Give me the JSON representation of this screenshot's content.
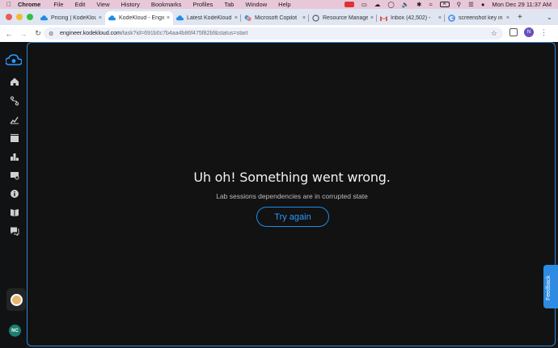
{
  "menubar": {
    "app": "Chrome",
    "items": [
      "File",
      "Edit",
      "View",
      "History",
      "Bookmarks",
      "Profiles",
      "Tab",
      "Window",
      "Help"
    ],
    "datetime": "Mon Dec 29  11:37 AM"
  },
  "tabs": [
    {
      "title": "Pricing | KodeKloud",
      "favicon": "kodekloud-cloud-icon",
      "active": false
    },
    {
      "title": "KodeKloud - Engineer",
      "favicon": "kodekloud-cloud-icon",
      "active": true
    },
    {
      "title": "Latest KodeKloud",
      "favicon": "kodekloud-cloud-icon",
      "active": false
    },
    {
      "title": "Microsoft Copilot",
      "favicon": "copilot-icon",
      "active": false
    },
    {
      "title": "Resource Manager",
      "favicon": "globe-icon",
      "active": false
    },
    {
      "title": "Inbox (42,502) -",
      "favicon": "gmail-icon",
      "active": false
    },
    {
      "title": "screenshot key in",
      "favicon": "google-icon",
      "active": false
    }
  ],
  "omnibox": {
    "domain": "engineer.kodekloud.com",
    "path": "/task?id=691b0c7b4aa4b86f475f82bf&status=start"
  },
  "profile": {
    "initial": "N"
  },
  "sidebar": {
    "icons": [
      "home-icon",
      "route-icon",
      "chart-icon",
      "video-icon",
      "leaderboard-icon",
      "certificate-icon",
      "info-icon",
      "book-icon",
      "chat-icon"
    ],
    "user_initials": "NC"
  },
  "error": {
    "title": "Uh oh! Something went wrong.",
    "subtitle": "Lab sessions dependencies are in corrupted state",
    "button": "Try again"
  },
  "feedback": {
    "label": "Feedback"
  },
  "colors": {
    "accent": "#2a9aff",
    "background": "#121212",
    "sidebar": "#111214",
    "border": "#2c86d6"
  }
}
